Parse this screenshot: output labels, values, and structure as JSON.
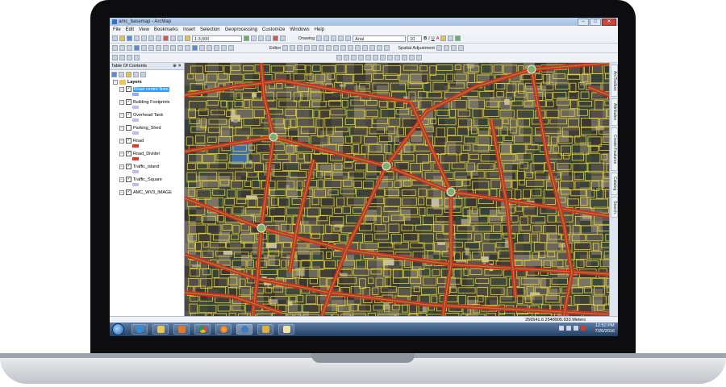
{
  "window": {
    "title": "amc_basemap - ArcMap"
  },
  "menu": [
    "File",
    "Edit",
    "View",
    "Bookmarks",
    "Insert",
    "Selection",
    "Geoprocessing",
    "Customize",
    "Windows",
    "Help"
  ],
  "toolbar": {
    "scale": "1:3,000",
    "drawing_label": "Drawing",
    "font": "Arial",
    "font_size": "10",
    "editor_label": "Editor",
    "spatial_adjustment_label": "Spatial Adjustment",
    "bold": "B",
    "italic": "I",
    "underline": "U",
    "text_color": "A"
  },
  "toc": {
    "title": "Table Of Contents",
    "root": "Layers",
    "layers": [
      {
        "label": "Road centre lines",
        "checked": true,
        "selected": true,
        "swatch": "#9aa6ff"
      },
      {
        "label": "Building Footprints",
        "checked": true,
        "selected": false,
        "swatch": "#c8b8f0"
      },
      {
        "label": "Overhead Tank",
        "checked": true,
        "selected": false,
        "swatch": "#c8b8f0"
      },
      {
        "label": "Parking_Shed",
        "checked": false,
        "selected": false,
        "swatch": "#c8b8f0"
      },
      {
        "label": "Road",
        "checked": true,
        "selected": false,
        "swatch": "#e63a2b"
      },
      {
        "label": "Road_Divider",
        "checked": true,
        "selected": false,
        "swatch": "#e63a2b"
      },
      {
        "label": "Traffic_island",
        "checked": true,
        "selected": false,
        "swatch": "#c8b8f0"
      },
      {
        "label": "Traffic_Square",
        "checked": true,
        "selected": false,
        "swatch": "#c8b8f0"
      },
      {
        "label": "AMC_WV3_IMAGE",
        "checked": true,
        "selected": false,
        "swatch": ""
      }
    ]
  },
  "dock_tabs": [
    "ArcToolbox",
    "Attributes",
    "Create Features",
    "Catalog",
    "Search"
  ],
  "status": {
    "coordinates": "256541.6  2548905.933 Meters"
  },
  "taskbar": {
    "time": "12:52 PM",
    "date": "7/26/2016"
  },
  "colors": {
    "road": "#e2261b",
    "building": "#e0d233",
    "road_line": "#52b84a",
    "imagery": "#3c3a33"
  }
}
